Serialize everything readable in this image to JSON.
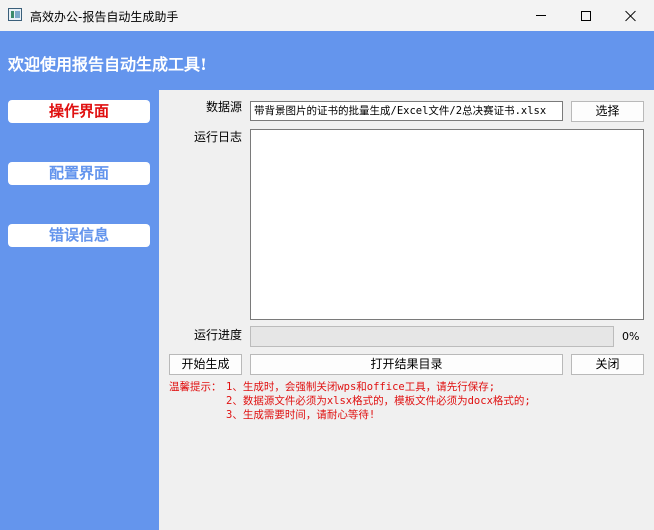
{
  "window": {
    "title": "高效办公-报告自动生成助手"
  },
  "header": {
    "title": "欢迎使用报告自动生成工具!"
  },
  "sidebar": {
    "items": [
      {
        "label": "操作界面",
        "active": true,
        "color": "#e01010"
      },
      {
        "label": "配置界面",
        "active": false,
        "color": "#6495ed"
      },
      {
        "label": "错误信息",
        "active": false,
        "color": "#6495ed"
      }
    ],
    "background": "#6495ed"
  },
  "form": {
    "datasource_label": "数据源",
    "datasource_value": "带背景图片的证书的批量生成/Excel文件/2总决赛证书.xlsx",
    "select_button": "选择",
    "log_label": "运行日志",
    "log_text": "",
    "progress_label": "运行进度",
    "progress_value": 0,
    "progress_text": "0%"
  },
  "actions": {
    "start": "开始生成",
    "open_dir": "打开结果目录",
    "close": "关闭"
  },
  "tips": {
    "prefix": "温馨提示：",
    "lines": [
      "1、生成时，会强制关闭wps和office工具，请先行保存;",
      "2、数据源文件必须为xlsx格式的，模板文件必须为docx格式的;",
      "3、生成需要时间，请耐心等待!"
    ],
    "color": "#e01010"
  }
}
